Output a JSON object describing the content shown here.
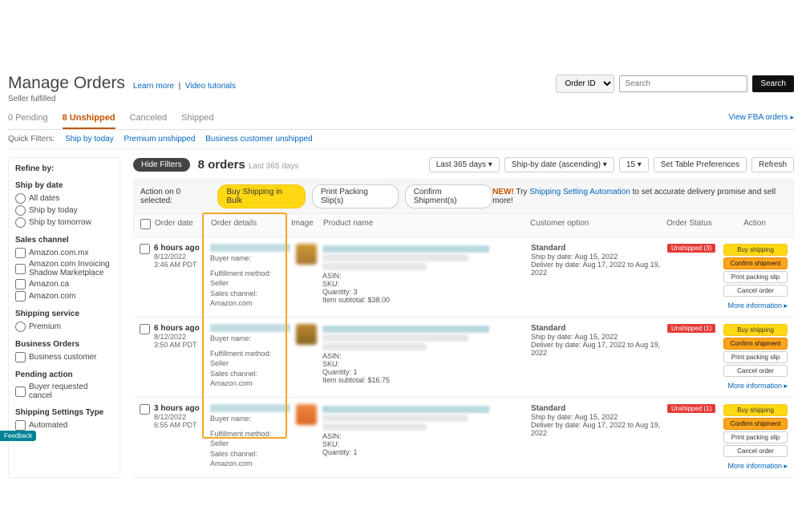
{
  "header": {
    "title": "Manage Orders",
    "learn_more": "Learn more",
    "video_tutorials": "Video tutorials",
    "subtitle": "Seller fulfilled",
    "search_type": "Order ID",
    "search_placeholder": "Search",
    "search_button": "Search"
  },
  "tabs": {
    "pending": {
      "count": "0",
      "label": "Pending"
    },
    "unshipped": {
      "count": "8",
      "label": "Unshipped"
    },
    "canceled": {
      "label": "Canceled"
    },
    "shipped": {
      "label": "Shipped"
    },
    "view_fba": "View FBA orders"
  },
  "quick_filters": {
    "label": "Quick Filters:",
    "items": [
      "Ship by today",
      "Premium unshipped",
      "Business customer unshipped"
    ]
  },
  "sidebar": {
    "refine": "Refine by:",
    "groups": [
      {
        "title": "Ship by date",
        "type": "radio",
        "items": [
          "All dates",
          "Ship by today",
          "Ship by tomorrow"
        ]
      },
      {
        "title": "Sales channel",
        "type": "check",
        "items": [
          "Amazon.com.mx",
          "Amazon.com Invoicing Shadow Marketplace",
          "Amazon.ca",
          "Amazon.com"
        ]
      },
      {
        "title": "Shipping service",
        "type": "radio",
        "items": [
          "Premium"
        ]
      },
      {
        "title": "Business Orders",
        "type": "check",
        "items": [
          "Business customer"
        ]
      },
      {
        "title": "Pending action",
        "type": "check",
        "items": [
          "Buyer requested cancel"
        ]
      },
      {
        "title": "Shipping Settings Type",
        "type": "check",
        "items": [
          "Automated"
        ]
      }
    ]
  },
  "orders_header": {
    "hide_filters": "Hide Filters",
    "count": "8 orders",
    "range": "Last 365 days",
    "toolbar": [
      "Last 365 days",
      "Ship-by date (ascending)",
      "15",
      "Set Table Preferences",
      "Refresh"
    ]
  },
  "action_bar": {
    "label": "Action on 0 selected:",
    "buy_bulk": "Buy Shipping in Bulk",
    "print_slips": "Print Packing Slip(s)",
    "confirm": "Confirm Shipment(s)",
    "promo_new": "NEW!",
    "promo_text1": "Try ",
    "promo_link": "Shipping Setting Automation",
    "promo_text2": " to set accurate delivery promise and sell more!"
  },
  "columns": {
    "date": "Order date",
    "details": "Order details",
    "image": "Image",
    "product": "Product name",
    "customer": "Customer option",
    "status": "Order Status",
    "action": "Action"
  },
  "rows": [
    {
      "ago": "6 hours ago",
      "date": "8/12/2022",
      "time": "3:46 AM PDT",
      "buyer_label": "Buyer name:",
      "fulfil": "Fulfillment method: Seller",
      "channel": "Sales channel: Amazon.com",
      "thumb_color": "linear-gradient(#c93,#a73)",
      "qty": "Quantity: 3",
      "subtotal": "Item subtotal: $38.00",
      "cust_title": "Standard",
      "ship_by": "Ship by date: Aug 15, 2022",
      "deliver": "Deliver by date: Aug 17, 2022 to Aug 19, 2022",
      "badge": "Unshipped (3)"
    },
    {
      "ago": "6 hours ago",
      "date": "8/12/2022",
      "time": "3:50 AM PDT",
      "buyer_label": "Buyer name:",
      "fulfil": "Fulfillment method: Seller",
      "channel": "Sales channel: Amazon.com",
      "thumb_color": "linear-gradient(#b83,#862)",
      "qty": "Quantity: 1",
      "subtotal": "Item subtotal: $16.75",
      "cust_title": "Standard",
      "ship_by": "Ship by date: Aug 15, 2022",
      "deliver": "Deliver by date: Aug 17, 2022 to Aug 19, 2022",
      "badge": "Unshipped (1)"
    },
    {
      "ago": "3 hours ago",
      "date": "8/12/2022",
      "time": "6:55 AM PDT",
      "buyer_label": "Buyer name:",
      "fulfil": "Fulfillment method: Seller",
      "channel": "Sales channel: Amazon.com",
      "thumb_color": "linear-gradient(#e84,#d62)",
      "qty": "Quantity: 1",
      "subtotal": "",
      "cust_title": "Standard",
      "ship_by": "Ship by date: Aug 15, 2022",
      "deliver": "Deliver by date: Aug 17, 2022 to Aug 19, 2022",
      "badge": "Unshipped (1)"
    }
  ],
  "actions": {
    "buy": "Buy shipping",
    "confirm": "Confirm shipment",
    "print": "Print packing slip",
    "cancel": "Cancel order",
    "more": "More information ▸"
  },
  "product_labels": {
    "asin": "ASIN:",
    "sku": "SKU:"
  },
  "feedback": "Feedback"
}
